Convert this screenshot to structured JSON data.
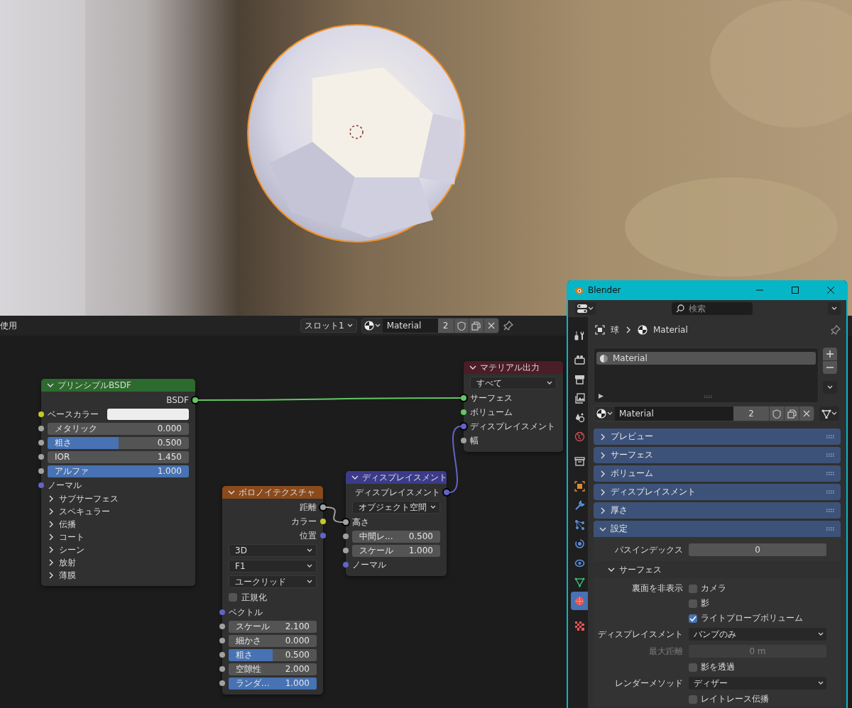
{
  "node_editor": {
    "header": {
      "mode": "使用",
      "slot": "スロット1",
      "material": "Material",
      "users": "2"
    },
    "nodes": [
      {
        "kind": "principled",
        "title": "プリンシプルBSDF",
        "color": "#2d6a2d",
        "rows": [
          {
            "kind": "output",
            "label": "BSDF",
            "color": "#63c763",
            "linked": true
          },
          {
            "kind": "color_input",
            "label": "ベースカラー",
            "color": "#c7c729",
            "swatch": {
              "color": "#ededed"
            }
          },
          {
            "kind": "slider",
            "label": "メタリック",
            "value": "0.000",
            "level": 0,
            "color": "#a1a1a1"
          },
          {
            "kind": "slider",
            "label": "粗さ",
            "value": "0.500",
            "level": 0.5,
            "color": "#a1a1a1"
          },
          {
            "kind": "number",
            "label": "IOR",
            "value": "1.450",
            "color": "#a1a1a1"
          },
          {
            "kind": "slider",
            "label": "アルファ",
            "value": "1.000",
            "level": 1,
            "color": "#a1a1a1"
          },
          {
            "kind": "input",
            "label": "ノーマル",
            "color": "#6363c7"
          },
          {
            "kind": "panel",
            "label": "サブサーフェス",
            "expanded": false
          },
          {
            "kind": "panel",
            "label": "スペキュラー",
            "expanded": false
          },
          {
            "kind": "panel",
            "label": "伝播",
            "expanded": false
          },
          {
            "kind": "panel",
            "label": "コート",
            "expanded": false
          },
          {
            "kind": "panel",
            "label": "シーン",
            "expanded": false
          },
          {
            "kind": "panel",
            "label": "放射",
            "expanded": false
          },
          {
            "kind": "panel",
            "label": "薄膜",
            "expanded": false
          }
        ]
      },
      {
        "kind": "voronoi",
        "title": "ボロノイテクスチャ",
        "color": "#8a4a1c",
        "rows": [
          {
            "kind": "output",
            "label": "距離",
            "color": "#a1a1a1",
            "linked": true
          },
          {
            "kind": "output",
            "label": "カラー",
            "color": "#c7c729"
          },
          {
            "kind": "output",
            "label": "位置",
            "color": "#6363c7"
          },
          {
            "kind": "dropdown",
            "value": "3D"
          },
          {
            "kind": "dropdown",
            "value": "F1"
          },
          {
            "kind": "dropdown",
            "value": "ユークリッド"
          },
          {
            "kind": "checkbox",
            "label": "正規化",
            "checked": false
          },
          {
            "kind": "input",
            "label": "ベクトル",
            "color": "#6363c7"
          },
          {
            "kind": "number",
            "label": "スケール",
            "value": "2.100",
            "color": "#a1a1a1"
          },
          {
            "kind": "number",
            "label": "細かさ",
            "value": "0.000",
            "color": "#a1a1a1"
          },
          {
            "kind": "slider",
            "label": "粗さ",
            "value": "0.500",
            "level": 0.5,
            "color": "#a1a1a1"
          },
          {
            "kind": "number",
            "label": "空隙性",
            "value": "2.000",
            "color": "#a1a1a1"
          },
          {
            "kind": "slider",
            "label": "ランダ...",
            "value": "1.000",
            "level": 1,
            "color": "#a1a1a1"
          }
        ]
      },
      {
        "kind": "displacement",
        "title": "ディスプレイスメント",
        "color": "#3b3b8a",
        "rows": [
          {
            "kind": "output",
            "label": "ディスプレイスメント",
            "color": "#6363c7",
            "linked": true
          },
          {
            "kind": "dropdown",
            "value": "オブジェクト空間"
          },
          {
            "kind": "input",
            "label": "高さ",
            "color": "#a1a1a1",
            "linked": true
          },
          {
            "kind": "number",
            "label": "中間レ...",
            "value": "0.500",
            "color": "#a1a1a1"
          },
          {
            "kind": "number",
            "label": "スケール",
            "value": "1.000",
            "color": "#a1a1a1"
          },
          {
            "kind": "input",
            "label": "ノーマル",
            "color": "#6363c7"
          }
        ]
      },
      {
        "kind": "output_node",
        "title": "マテリアル出力",
        "color": "#4b1d26",
        "rows": [
          {
            "kind": "dropdown",
            "value": "すべて"
          },
          {
            "kind": "input",
            "label": "サーフェス",
            "color": "#63c763",
            "linked": true
          },
          {
            "kind": "input",
            "label": "ボリューム",
            "color": "#63c763",
            "linked": false
          },
          {
            "kind": "input",
            "label": "ディスプレイスメント",
            "color": "#6363c7",
            "linked": true
          },
          {
            "kind": "input",
            "label": "幅",
            "color": "#a1a1a1",
            "linked": false
          }
        ]
      }
    ]
  },
  "properties": {
    "title": "Blender",
    "search": {
      "placeholder": "検索"
    },
    "tabs": [
      {
        "kind": "tool",
        "selected": false
      },
      {
        "kind": "render",
        "selected": false
      },
      {
        "kind": "output",
        "selected": false
      },
      {
        "kind": "view_layer",
        "selected": false
      },
      {
        "kind": "scene",
        "selected": false
      },
      {
        "kind": "world",
        "selected": false
      },
      {
        "kind": "collection",
        "selected": false
      },
      {
        "kind": "object",
        "selected": false
      },
      {
        "kind": "modifier",
        "selected": false
      },
      {
        "kind": "particles",
        "selected": false
      },
      {
        "kind": "physics",
        "selected": false
      },
      {
        "kind": "constraints",
        "selected": false
      },
      {
        "kind": "data",
        "selected": false
      },
      {
        "kind": "material",
        "selected": true
      },
      {
        "kind": "texture",
        "selected": false
      }
    ],
    "breadcrumb": [
      "球",
      "Material"
    ],
    "slots": [
      {
        "name": "Material",
        "selected": true
      }
    ],
    "datablock": {
      "name": "Material",
      "users": "2"
    },
    "panels": [
      {
        "label": "プレビュー",
        "expanded": false
      },
      {
        "label": "サーフェス",
        "expanded": false
      },
      {
        "label": "ボリューム",
        "expanded": false
      },
      {
        "label": "ディスプレイスメント",
        "expanded": false
      },
      {
        "label": "厚さ",
        "expanded": false
      },
      {
        "label": "設定",
        "expanded": true,
        "rows": [
          {
            "kind": "number",
            "label": "パスインデックス",
            "value": "0",
            "disabled": false
          },
          {
            "kind": "subpanel",
            "label": "サーフェス",
            "expanded": true
          },
          {
            "kind": "checkbox",
            "label": "裏面を非表示",
            "text": "カメラ",
            "checked": false
          },
          {
            "kind": "checkbox",
            "text": "影",
            "checked": false
          },
          {
            "kind": "checkbox",
            "text": "ライトプローブボリューム",
            "checked": true
          },
          {
            "kind": "dropdown",
            "label": "ディスプレイスメント",
            "value": "バンプのみ"
          },
          {
            "kind": "number",
            "label": "最大距離",
            "value": "0 m",
            "disabled": true
          },
          {
            "kind": "checkbox",
            "text": "影を透過",
            "checked": false
          },
          {
            "kind": "dropdown",
            "label": "レンダーメソッド",
            "value": "ディザー"
          },
          {
            "kind": "checkbox",
            "text": "レイトレース伝播",
            "checked": false
          }
        ]
      }
    ]
  }
}
